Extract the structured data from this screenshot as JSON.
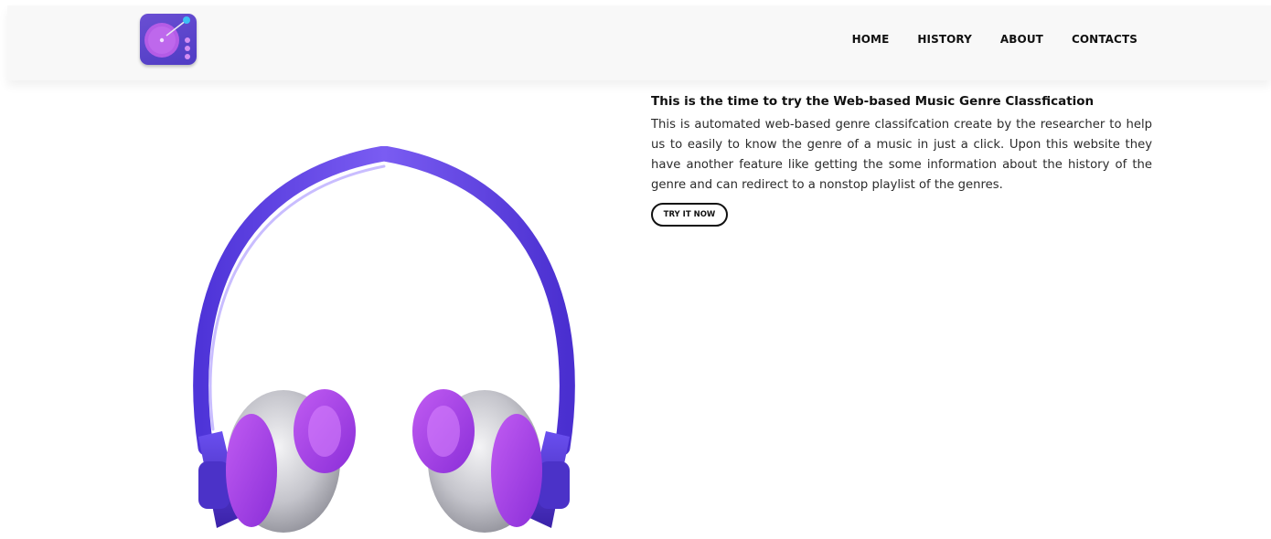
{
  "nav": {
    "logo_icon": "turntable-icon",
    "links": [
      {
        "label": "HOME"
      },
      {
        "label": "HISTORY"
      },
      {
        "label": "ABOUT"
      },
      {
        "label": "CONTACTS"
      }
    ]
  },
  "hero": {
    "image_icon": "headphones-image",
    "headline": "This is the time to try the Web-based Music Genre Classfication",
    "description": "This is automated web-based genre classifcation create by the researcher to help us to easily to know the genre of a music in just a click. Upon this website they have another feature like getting the some information about the history of the genre and can redirect to a nonstop playlist of the genres.",
    "cta_label": "TRY IT NOW"
  },
  "colors": {
    "accent_purple": "#6a4fd3",
    "band_blue": "#5a3ee6",
    "earcup_purple": "#a43de8",
    "earcup_silver": "#c9c9cf",
    "text_dark": "#111111"
  }
}
